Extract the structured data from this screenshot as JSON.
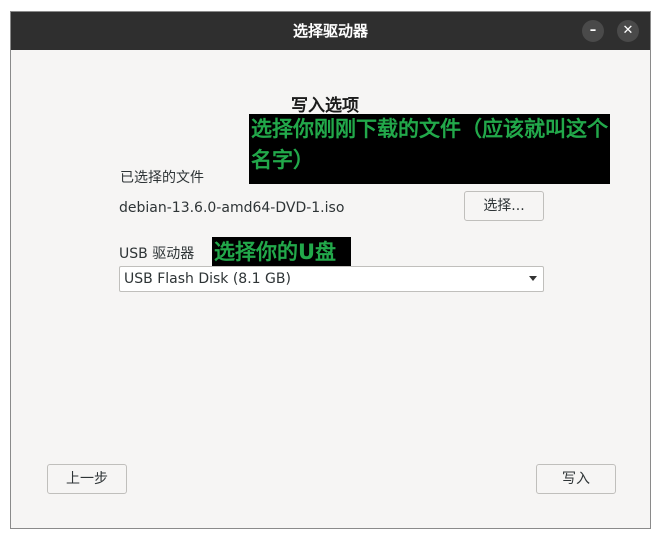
{
  "window": {
    "title": "选择驱动器",
    "minimize_glyph": "–",
    "close_glyph": "✕"
  },
  "heading": "写入选项",
  "annotations": {
    "file_hint": "选择你刚刚下载的文件（应该就叫这个名字）",
    "usb_hint": "选择你的U盘"
  },
  "file": {
    "label": "已选择的文件",
    "name": "debian-13.6.0-amd64-DVD-1.iso",
    "choose_button": "选择..."
  },
  "usb": {
    "label": "USB 驱动器",
    "selected": "USB Flash Disk (8.1 GB)"
  },
  "footer": {
    "back_button": "上一步",
    "write_button": "写入"
  },
  "icons": {
    "minimize": "minimize-icon",
    "close": "close-icon",
    "dropdown": "chevron-down-icon"
  }
}
